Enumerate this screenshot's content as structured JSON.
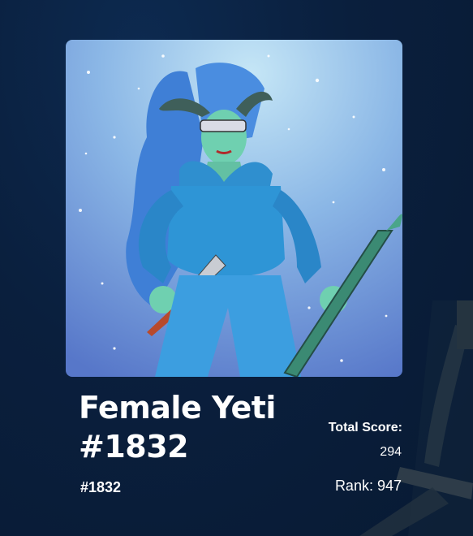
{
  "nft": {
    "title": "Female Yeti #1832",
    "token_id": "#1832",
    "image_alt": "Female Yeti character illustration"
  },
  "stats": {
    "total_score_label": "Total Score:",
    "total_score_value": "294",
    "rank_text": "Rank: 947"
  },
  "colors": {
    "page_background": "#0a1f3d",
    "text": "#ffffff",
    "art_background_top": "#a9d6ef",
    "art_background_bottom": "#5f83cf"
  }
}
